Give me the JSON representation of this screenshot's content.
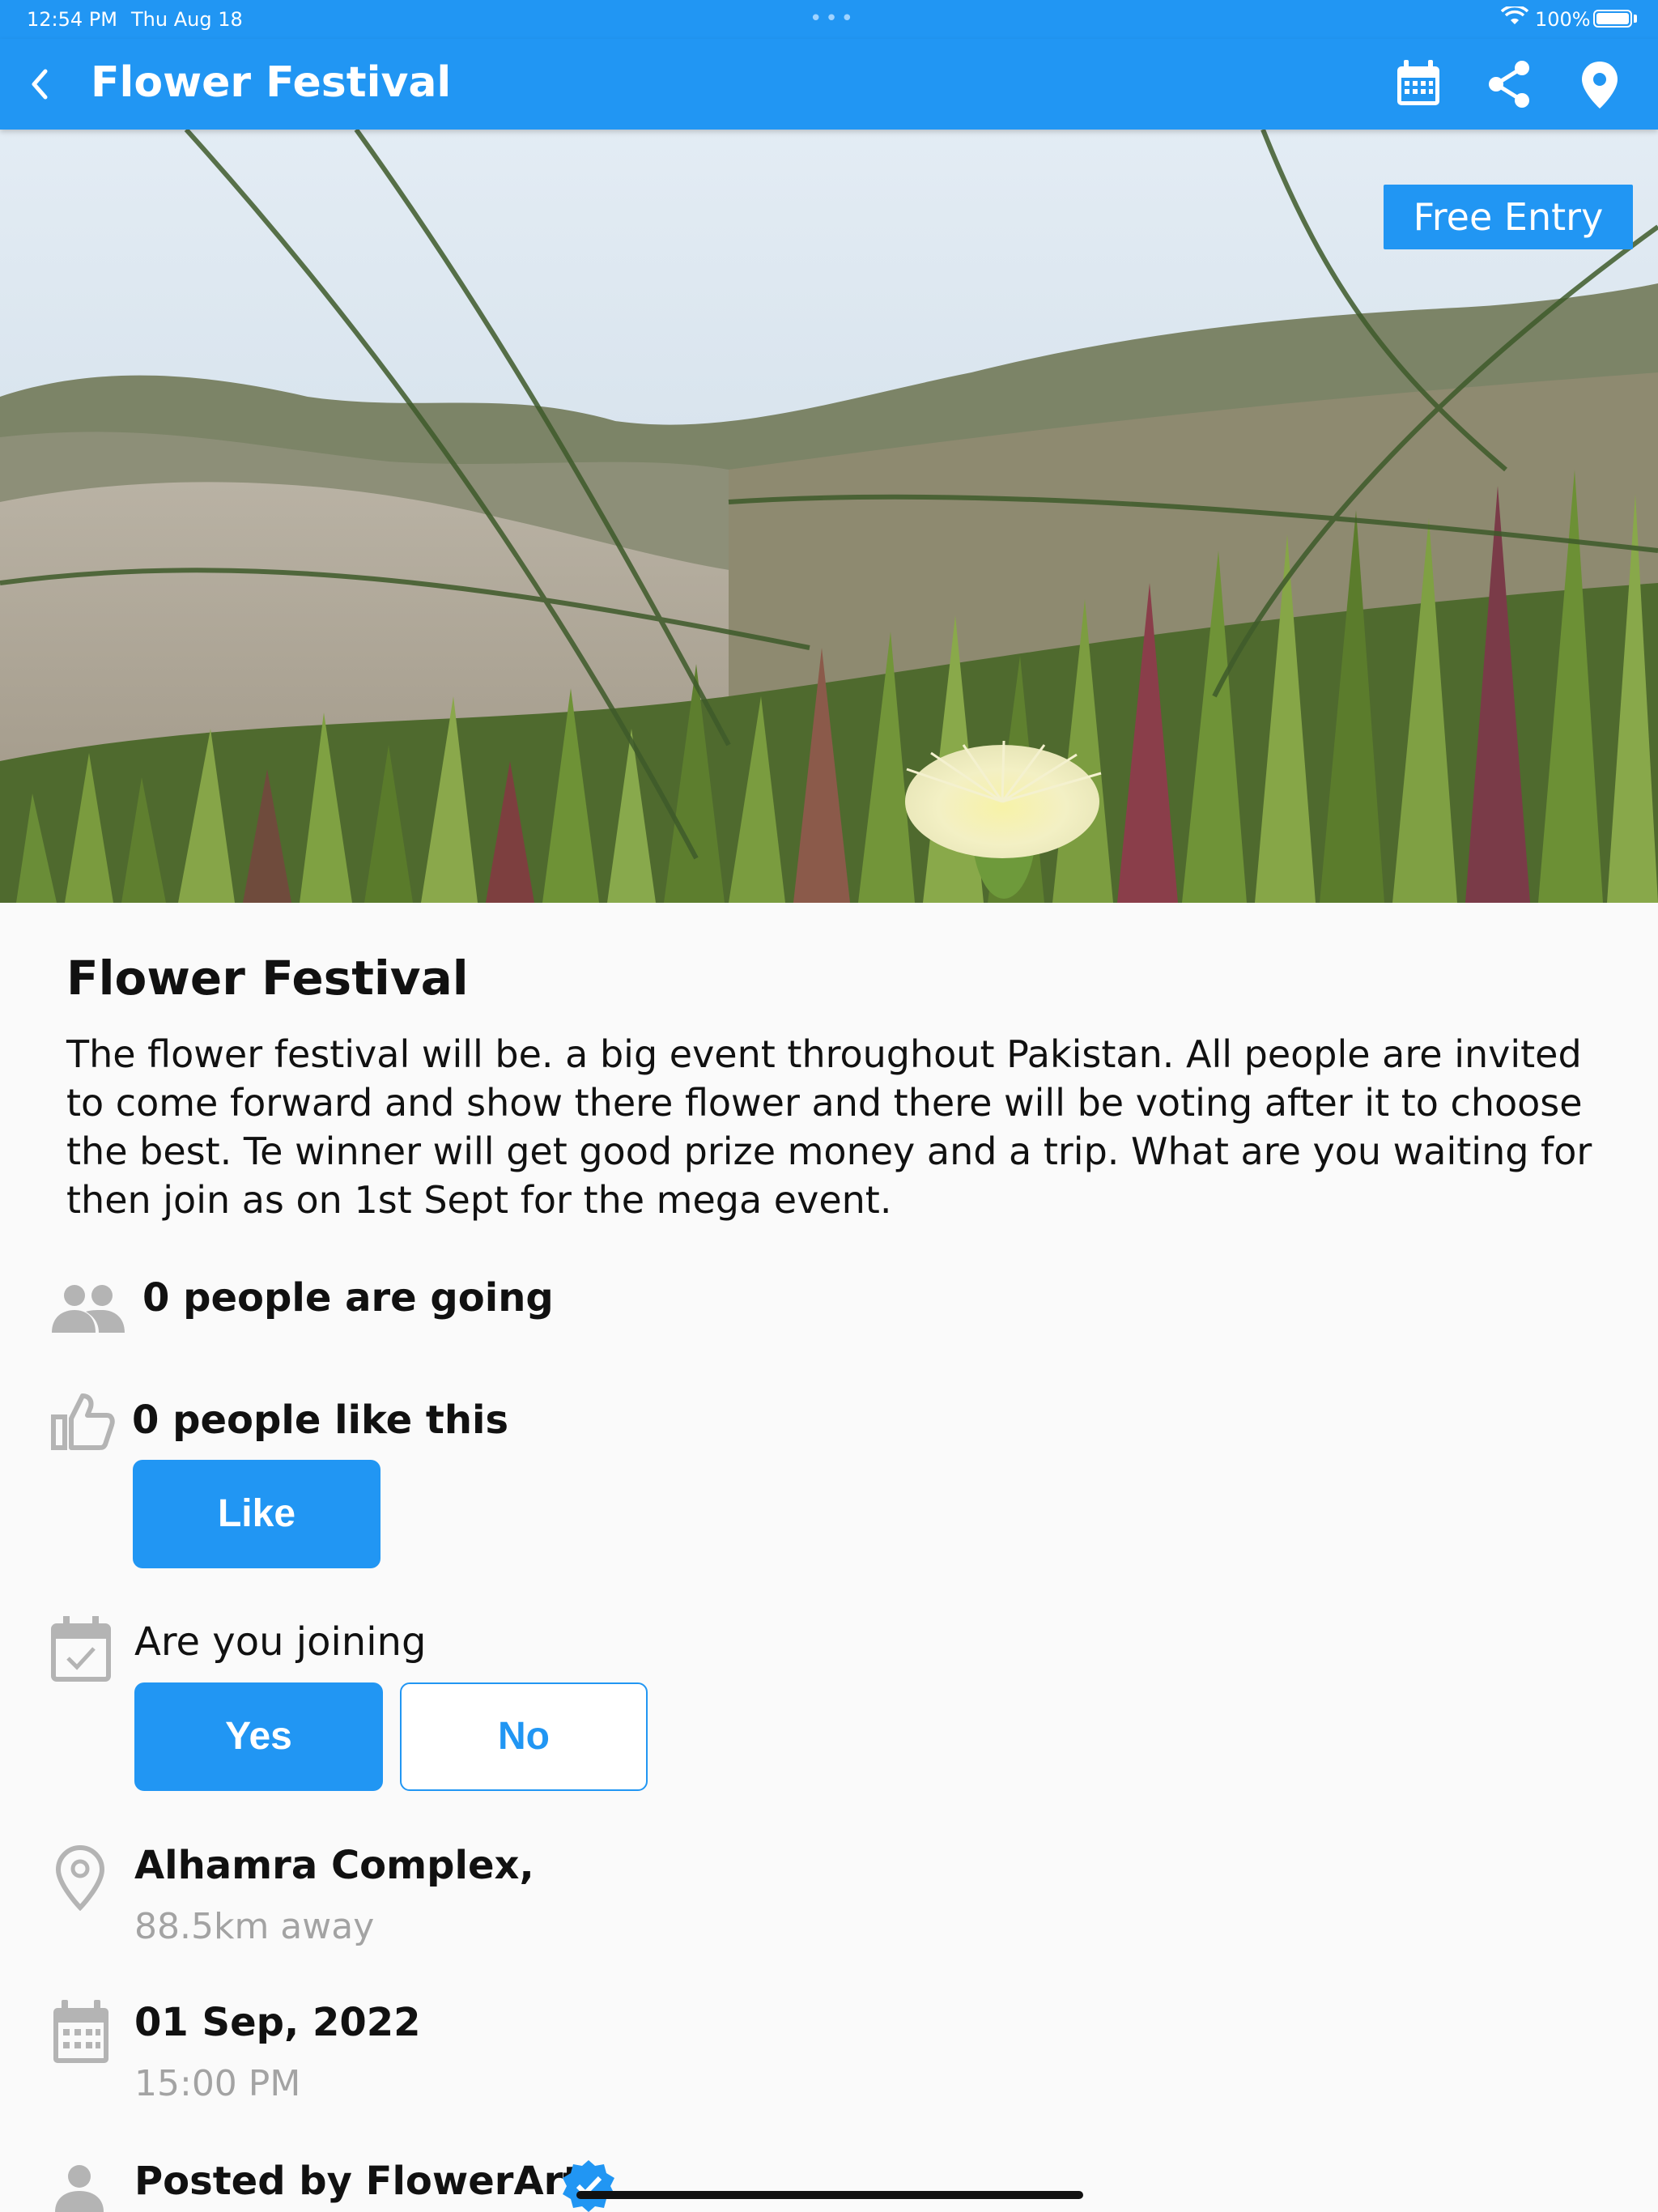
{
  "status_bar": {
    "time": "12:54 PM",
    "date": "Thu Aug 18",
    "dots": "•••",
    "battery": "100%"
  },
  "app_bar": {
    "title": "Flower Festival",
    "back_icon": "chevron-left-icon",
    "actions": [
      "calendar-icon",
      "share-icon",
      "location-pin-icon"
    ]
  },
  "hero": {
    "badge": "Free Entry"
  },
  "event": {
    "title": "Flower Festival",
    "description": "The flower festival will be. a big event throughout Pakistan. All people are invited to come forward and show there flower and there will be voting after it to choose the best. Te winner will get good prize money and a trip. What are you waiting for then join as on 1st Sept for the mega event."
  },
  "going": {
    "text": "0 people are going",
    "icon": "people-icon"
  },
  "likes": {
    "text": "0 people like this",
    "icon": "thumbs-up-icon",
    "button": "Like"
  },
  "joining": {
    "question": "Are you joining",
    "icon": "calendar-check-icon",
    "yes": "Yes",
    "no": "No",
    "selected": "Yes"
  },
  "location": {
    "name": "Alhamra Complex,",
    "distance": "88.5km away",
    "icon": "location-pin-icon"
  },
  "date_time": {
    "date": "01 Sep, 2022",
    "time": "15:00 PM",
    "icon": "calendar-icon"
  },
  "posted_by": {
    "text": "Posted by FlowerArt",
    "icon": "person-icon",
    "verified_icon": "verified-badge-icon"
  },
  "colors": {
    "primary": "#2196f3",
    "icon_gray": "#b4b4b4",
    "muted_text": "#a3a3a3"
  }
}
